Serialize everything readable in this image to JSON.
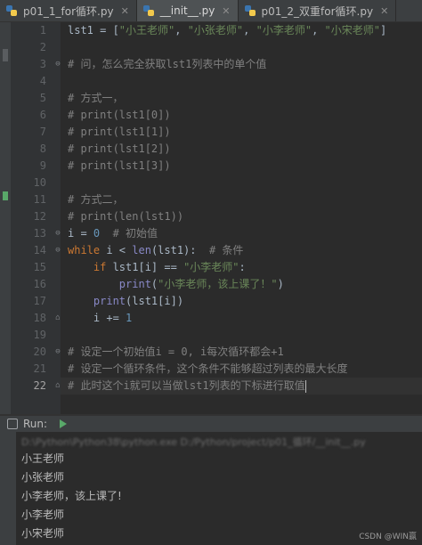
{
  "tabs": [
    {
      "label": "p01_1_for循环.py",
      "active": false
    },
    {
      "label": "__init__.py",
      "active": true
    },
    {
      "label": "p01_2_双重for循环.py",
      "active": false
    }
  ],
  "lines": [
    {
      "n": "1"
    },
    {
      "n": "2"
    },
    {
      "n": "3"
    },
    {
      "n": "4"
    },
    {
      "n": "5"
    },
    {
      "n": "6"
    },
    {
      "n": "7"
    },
    {
      "n": "8"
    },
    {
      "n": "9"
    },
    {
      "n": "10"
    },
    {
      "n": "11"
    },
    {
      "n": "12"
    },
    {
      "n": "13"
    },
    {
      "n": "14"
    },
    {
      "n": "15"
    },
    {
      "n": "16"
    },
    {
      "n": "17"
    },
    {
      "n": "18"
    },
    {
      "n": "19"
    },
    {
      "n": "20"
    },
    {
      "n": "21"
    },
    {
      "n": "22"
    }
  ],
  "code": {
    "l1": {
      "a": "lst1 = [",
      "s1": "\"小王老师\"",
      "c1": ", ",
      "s2": "\"小张老师\"",
      "c2": ", ",
      "s3": "\"小李老师\"",
      "c3": ", ",
      "s4": "\"小宋老师\"",
      "e": "]"
    },
    "l3": "# 问，怎么完全获取lst1列表中的单个值",
    "l5": "# 方式一，",
    "l6": "# print(lst1[0])",
    "l7": "# print(lst1[1])",
    "l8": "# print(lst1[2])",
    "l9": "# print(lst1[3])",
    "l11": "# 方式二，",
    "l12": "# print(len(lst1))",
    "l13": {
      "a": "i = ",
      "n": "0",
      "c": "  # 初始值"
    },
    "l14": {
      "kw": "while",
      "a": " i < ",
      "fn": "len",
      "b": "(lst1):  ",
      "c": "# 条件"
    },
    "l15": {
      "ind": "    ",
      "kw": "if",
      "a": " lst1[i] == ",
      "s": "\"小李老师\"",
      "b": ":"
    },
    "l16": {
      "ind": "        ",
      "fn": "print",
      "a": "(",
      "s": "\"小李老师，该上课了！\"",
      "b": ")"
    },
    "l17": {
      "ind": "    ",
      "fn": "print",
      "a": "(lst1[i])"
    },
    "l18": {
      "ind": "    ",
      "a": "i += ",
      "n": "1"
    },
    "l20": "# 设定一个初始值i = 0, i每次循环都会+1",
    "l21": "# 设定一个循环条件，这个条件不能够超过列表的最大长度",
    "l22": "# 此时这个i就可以当做lst1列表的下标进行取值"
  },
  "run": {
    "label": "Run:",
    "command": "D:\\Python\\Python38\\python.exe D:/Python/project/p01_循环/__init__.py",
    "output": [
      "小王老师",
      "小张老师",
      "小李老师，该上课了!",
      "小李老师",
      "小宋老师"
    ]
  },
  "watermark": "CSDN @WIN赢"
}
